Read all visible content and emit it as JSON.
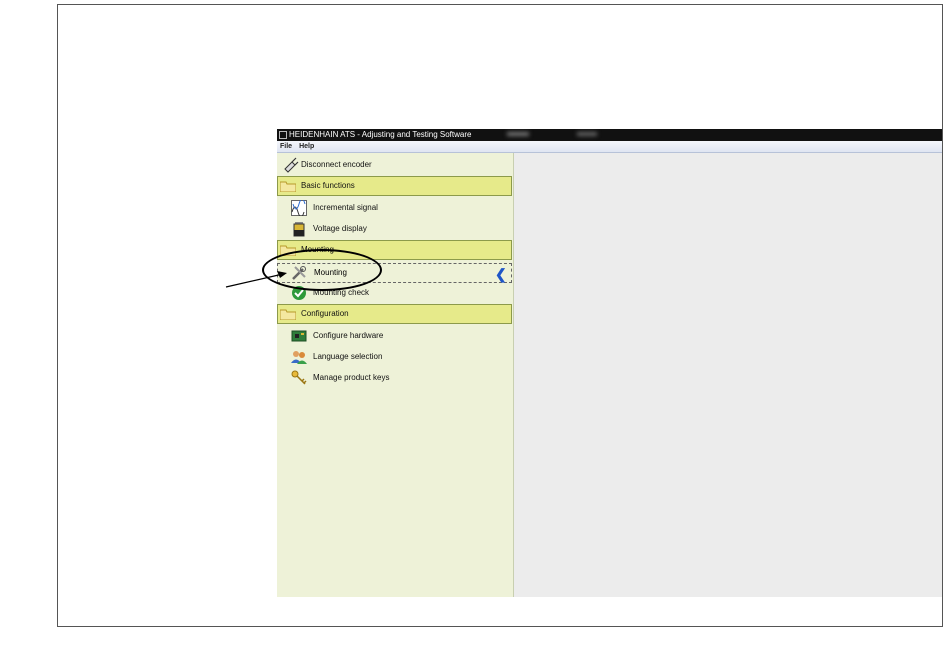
{
  "window": {
    "title": "HEIDENHAIN ATS - Adjusting and Testing Software"
  },
  "menu": {
    "file": "File",
    "help": "Help"
  },
  "sidebar": {
    "disconnect": "Disconnect encoder",
    "basic_functions": "Basic functions",
    "incremental_signal": "Incremental signal",
    "voltage_display": "Voltage display",
    "mounting_group": "Mounting",
    "mounting_item": "Mounting",
    "mounting_check": "Mounting check",
    "configuration": "Configuration",
    "configure_hardware": "Configure hardware",
    "language_selection": "Language selection",
    "manage_product_keys": "Manage product keys"
  },
  "icons": {
    "disconnect": "disconnect-plug-icon",
    "folder": "folder-icon",
    "incremental": "signal-graph-icon",
    "voltage": "battery-icon",
    "mounting": "tools-icon",
    "check": "check-circle-icon",
    "hardware": "circuit-board-icon",
    "language": "people-icon",
    "keys": "keys-icon",
    "collapse": "chevron-left-icon"
  },
  "colors": {
    "sidebar_bg": "#eef2d8",
    "group_bg": "#e6ea8a",
    "accent_chevron": "#1f56c7"
  }
}
